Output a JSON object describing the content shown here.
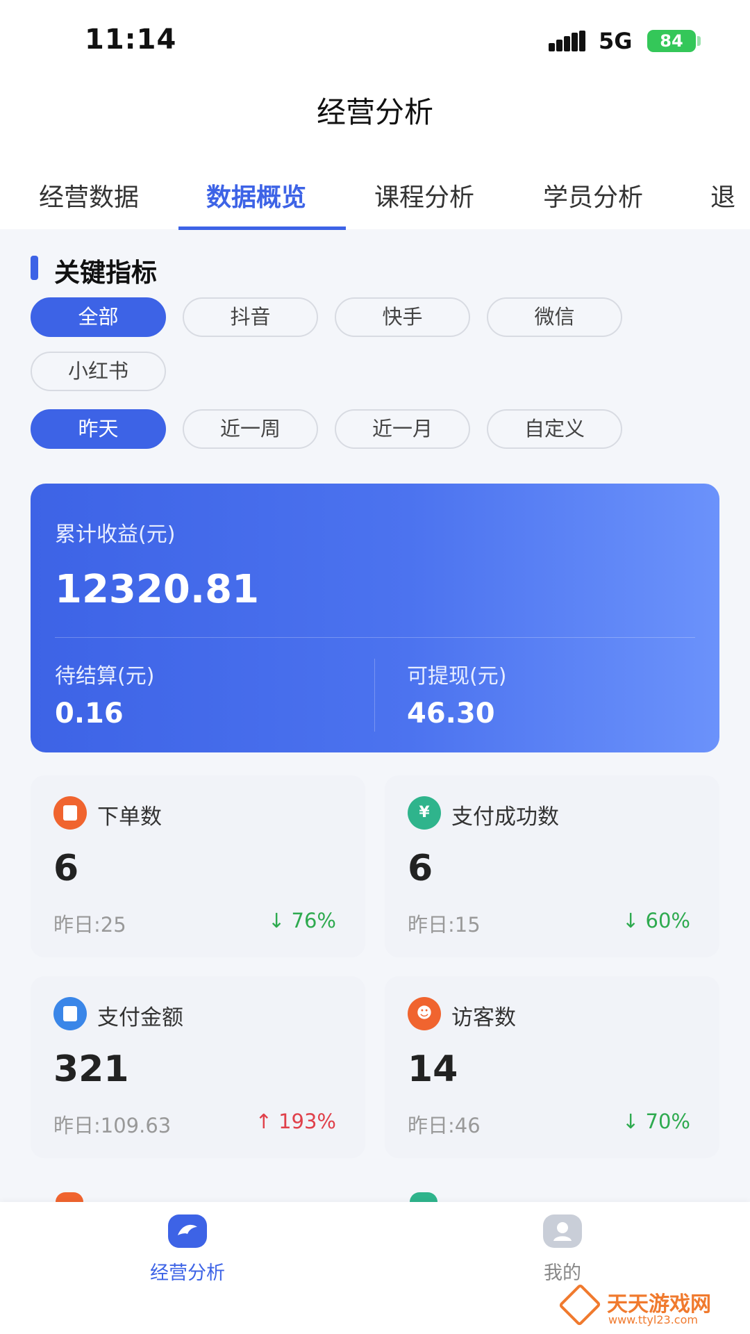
{
  "status_bar": {
    "time": "11:14",
    "network": "5G",
    "battery": "84"
  },
  "header": {
    "title": "经营分析"
  },
  "tabs": [
    {
      "label": "经营数据",
      "active": false
    },
    {
      "label": "数据概览",
      "active": true
    },
    {
      "label": "课程分析",
      "active": false
    },
    {
      "label": "学员分析",
      "active": false
    },
    {
      "label": "退",
      "active": false
    }
  ],
  "section": {
    "title": "关键指标"
  },
  "platform_filters": [
    {
      "label": "全部",
      "active": true
    },
    {
      "label": "抖音",
      "active": false
    },
    {
      "label": "快手",
      "active": false
    },
    {
      "label": "微信",
      "active": false
    },
    {
      "label": "小红书",
      "active": false
    }
  ],
  "period_filters": [
    {
      "label": "昨天",
      "active": true
    },
    {
      "label": "近一周",
      "active": false
    },
    {
      "label": "近一月",
      "active": false
    },
    {
      "label": "自定义",
      "active": false
    }
  ],
  "revenue": {
    "label": "累计收益(元)",
    "value": "12320.81",
    "pending_label": "待结算(元)",
    "pending_value": "0.16",
    "withdrawable_label": "可提现(元)",
    "withdrawable_value": "46.30"
  },
  "metrics": [
    {
      "label": "下单数",
      "value": "6",
      "previous": "昨日:25",
      "change": "↓ 76%",
      "direction": "down",
      "icon": "order-icon",
      "color": "#f0642f"
    },
    {
      "label": "支付成功数",
      "value": "6",
      "previous": "昨日:15",
      "change": "↓ 60%",
      "direction": "down",
      "icon": "payment-success-icon",
      "color": "#2fb48c"
    },
    {
      "label": "支付金额",
      "value": "321",
      "previous": "昨日:109.63",
      "change": "↑ 193%",
      "direction": "up",
      "icon": "payment-amount-icon",
      "color": "#3a86e8"
    },
    {
      "label": "访客数",
      "value": "14",
      "previous": "昨日:46",
      "change": "↓ 70%",
      "direction": "down",
      "icon": "visitors-icon",
      "color": "#f0642f"
    }
  ],
  "bottom_nav": [
    {
      "label": "经营分析",
      "active": true,
      "icon": "business-analysis-icon"
    },
    {
      "label": "我的",
      "active": false,
      "icon": "profile-icon"
    }
  ],
  "watermark": {
    "text": "天天游戏网",
    "url": "www.ttyl23.com"
  },
  "colors": {
    "accent": "#3d63e6",
    "down": "#2eaa4f",
    "up": "#e0404a"
  }
}
